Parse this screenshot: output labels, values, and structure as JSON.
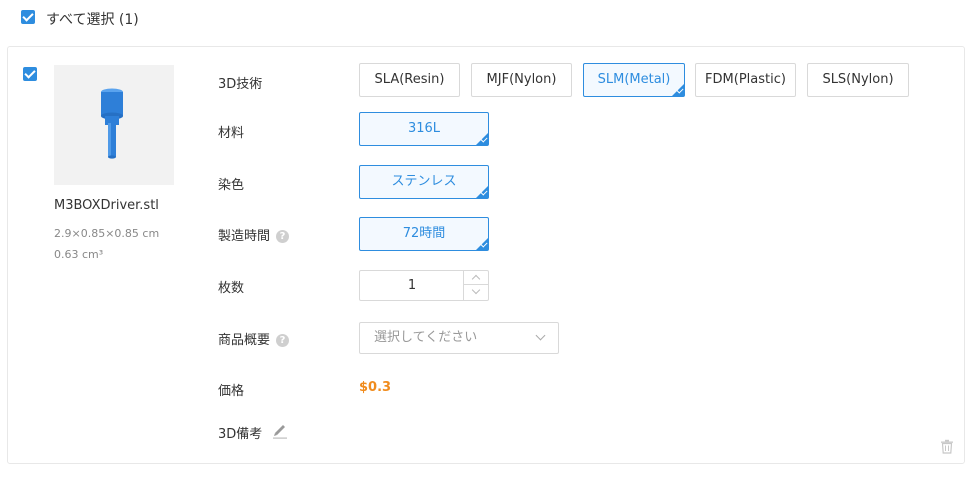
{
  "header": {
    "select_all_label": "すべて選択 (1)",
    "select_all_checked": true
  },
  "item": {
    "checked": true,
    "file_name": "M3BOXDriver.stl",
    "dimensions": "2.9×0.85×0.85 cm",
    "volume": "0.63 cm³",
    "model_color": "#2e7fd8",
    "icons": {
      "edit": "pencil-icon",
      "delete": "trash-icon",
      "help": "question-icon"
    }
  },
  "form": {
    "tech": {
      "label": "3D技術",
      "options": [
        "SLA(Resin)",
        "MJF(Nylon)",
        "SLM(Metal)",
        "FDM(Plastic)",
        "SLS(Nylon)"
      ],
      "selected": "SLM(Metal)"
    },
    "material": {
      "label": "材料",
      "value": "316L"
    },
    "color": {
      "label": "染色",
      "value": "ステンレス"
    },
    "lead_time": {
      "label": "製造時間",
      "value": "72時間"
    },
    "quantity": {
      "label": "枚数",
      "value": "1"
    },
    "summary": {
      "label": "商品概要",
      "placeholder": "選択してください"
    },
    "price": {
      "label": "価格",
      "value": "$0.3"
    },
    "note": {
      "label": "3D備考"
    }
  },
  "colors": {
    "accent": "#2e8ddf",
    "price": "#f08c1e",
    "border": "#d9d9d9"
  }
}
